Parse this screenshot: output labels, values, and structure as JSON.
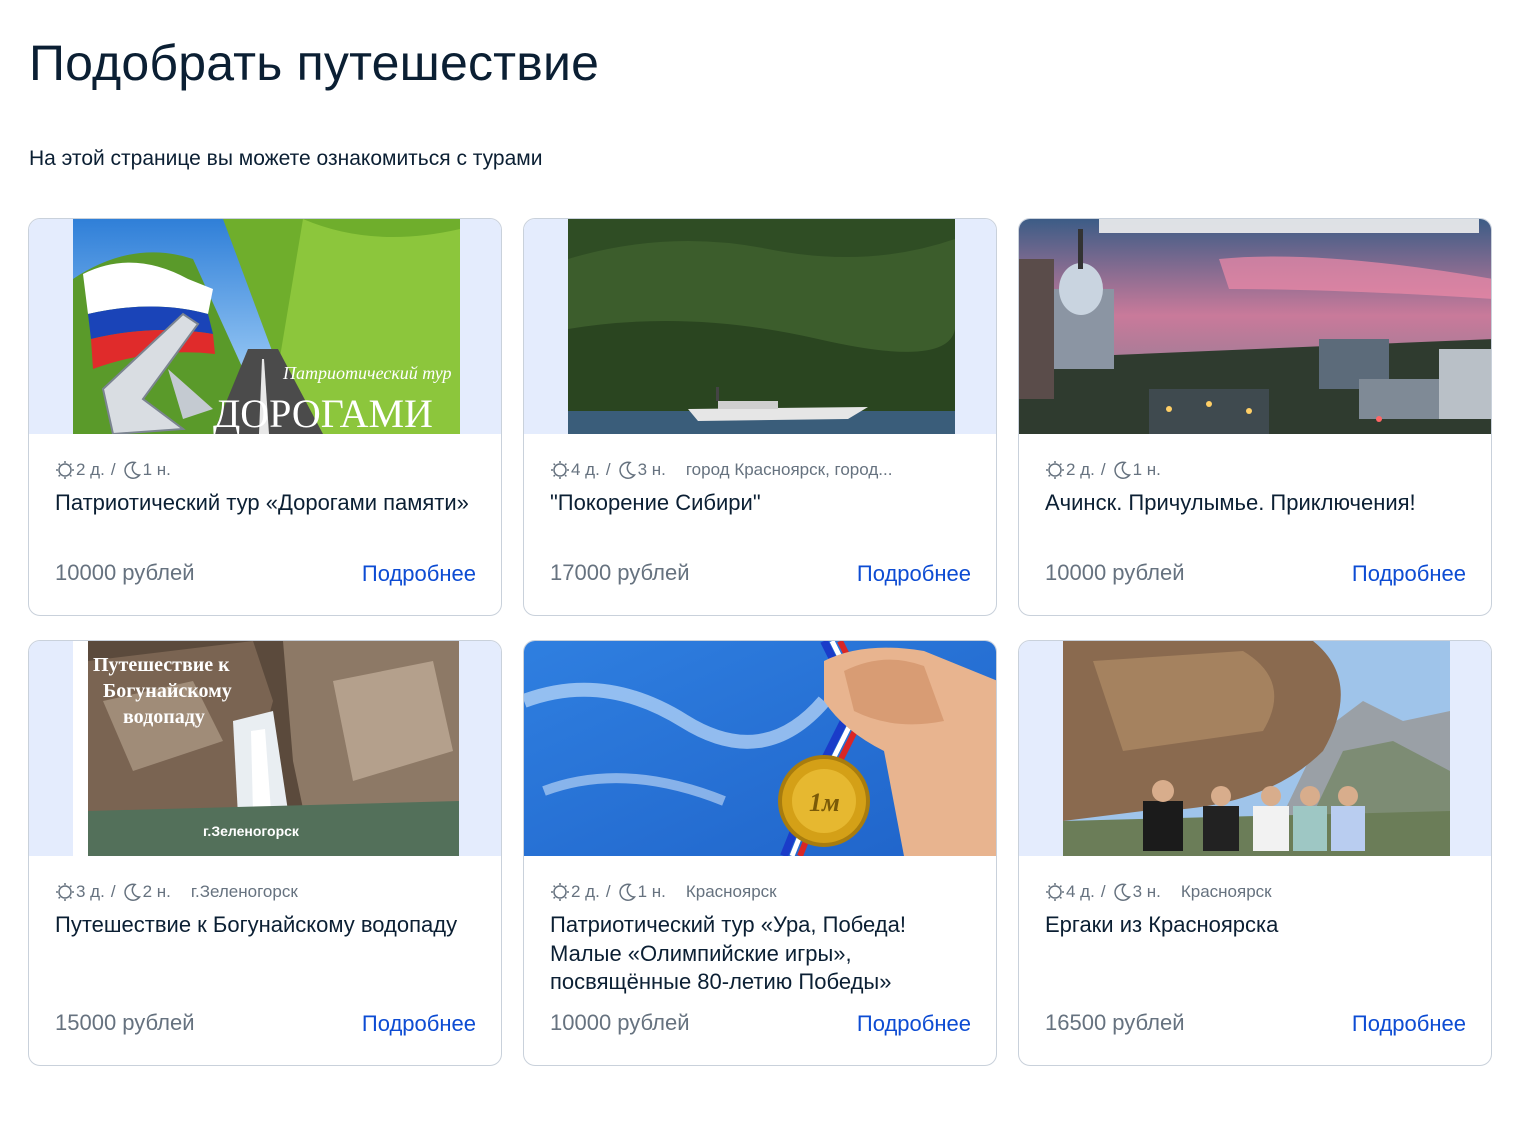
{
  "page": {
    "title": "Подобрать путешествие",
    "subtitle": "На этой странице вы можете ознакомиться с турами"
  },
  "tours": [
    {
      "days": "2 д.",
      "nights": "1 н.",
      "location": "",
      "name": "Патриотический тур «Дорогами памяти»",
      "price": "10000 рублей",
      "more_label": "Подробнее",
      "image_text": [
        "Патриотический тур",
        "ДОРОГАМИ"
      ]
    },
    {
      "days": "4 д.",
      "nights": "3 н.",
      "location": "город Красноярск, город...",
      "name": "\"Покорение Сибири\"",
      "price": "17000 рублей",
      "more_label": "Подробнее"
    },
    {
      "days": "2 д.",
      "nights": "1 н.",
      "location": "",
      "name": "Ачинск. Причулымье. Приключения!",
      "price": "10000 рублей",
      "more_label": "Подробнее"
    },
    {
      "days": "3 д.",
      "nights": "2 н.",
      "location": "г.Зеленогорск",
      "name": "Путешествие к Богунайскому водопаду",
      "price": "15000 рублей",
      "more_label": "Подробнее",
      "image_text": [
        "Путешествие к",
        "Богунайскому",
        "водопаду",
        "г.Зеленогорск"
      ]
    },
    {
      "days": "2 д.",
      "nights": "1 н.",
      "location": "Красноярск",
      "name": "Патриотический тур «Ура, Победа! Малые «Олимпийские игры», посвящённые 80-летию Победы»",
      "price": "10000 рублей",
      "more_label": "Подробнее",
      "image_text": [
        "1м"
      ]
    },
    {
      "days": "4 д.",
      "nights": "3 н.",
      "location": "Красноярск",
      "name": "Ергаки из Красноярска",
      "price": "16500 рублей",
      "more_label": "Подробнее"
    }
  ],
  "icons": {
    "day": "sun-icon",
    "night": "moon-icon"
  },
  "colors": {
    "link": "#0d4cd3",
    "muted": "#66727f",
    "image_backdrop": "#e4ecfd",
    "card_border": "#c9d1db"
  }
}
